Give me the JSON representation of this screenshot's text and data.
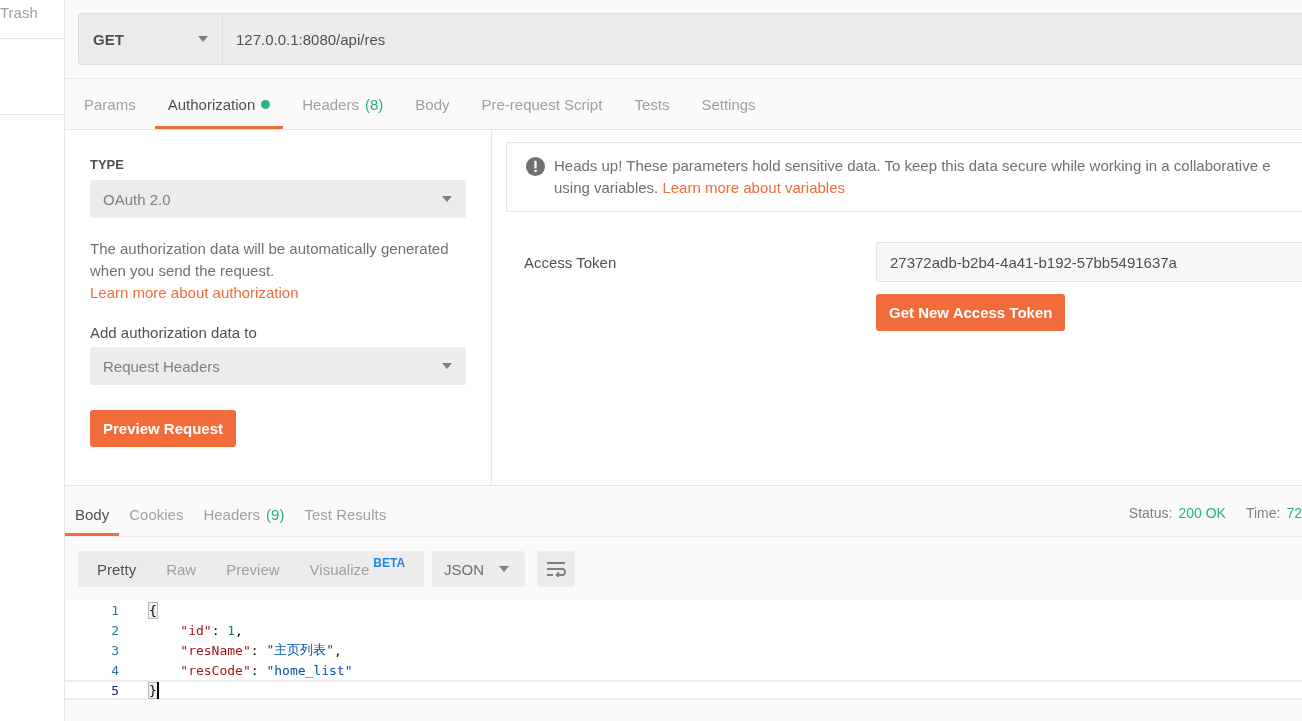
{
  "sidebar": {
    "items": [
      {
        "label": "Trash"
      }
    ]
  },
  "request": {
    "method": "GET",
    "url": "127.0.0.1:8080/api/res"
  },
  "request_tabs": [
    {
      "label": "Params",
      "selected": false
    },
    {
      "label": "Authorization",
      "selected": true,
      "dot": true
    },
    {
      "label": "Headers",
      "count": "(8)",
      "selected": false
    },
    {
      "label": "Body",
      "selected": false
    },
    {
      "label": "Pre-request Script",
      "selected": false
    },
    {
      "label": "Tests",
      "selected": false
    },
    {
      "label": "Settings",
      "selected": false
    }
  ],
  "auth": {
    "type_label": "TYPE",
    "type": "OAuth 2.0",
    "description": "The authorization data will be automatically generated when you send the request. ",
    "description_link": "Learn more about authorization",
    "add_to_label": "Add authorization data to",
    "add_to": "Request Headers",
    "preview_button": "Preview Request"
  },
  "notice": {
    "line_1": "Heads up! These parameters hold sensitive data. To keep this data secure while working in a collaborative e",
    "line_2": "using variables. ",
    "link": "Learn more about variables"
  },
  "access_token": {
    "label": "Access Token",
    "value": "27372adb-b2b4-4a41-b192-57bb5491637a",
    "button": "Get New Access Token"
  },
  "response_tabs": [
    {
      "label": "Body",
      "selected": true
    },
    {
      "label": "Cookies",
      "selected": false
    },
    {
      "label": "Headers",
      "count": "(9)",
      "selected": false
    },
    {
      "label": "Test Results",
      "selected": false
    }
  ],
  "status": {
    "label": "Status:",
    "value": "200 OK"
  },
  "time": {
    "label": "Time:",
    "value": "72"
  },
  "view_modes": [
    {
      "label": "Pretty",
      "selected": true
    },
    {
      "label": "Raw",
      "selected": false
    },
    {
      "label": "Preview",
      "selected": false
    },
    {
      "label": "Visualize",
      "badge": "BETA",
      "selected": false
    }
  ],
  "format": "JSON",
  "code": {
    "lines": [
      {
        "number": "1",
        "active": false,
        "tokens": [
          {
            "kind": "bracket",
            "text": "{"
          }
        ]
      },
      {
        "number": "2",
        "active": false,
        "tokens": [
          {
            "kind": "key",
            "text": "    \"id\""
          },
          {
            "kind": "punct",
            "text": ": "
          },
          {
            "kind": "number",
            "text": "1"
          },
          {
            "kind": "punct",
            "text": ","
          }
        ]
      },
      {
        "number": "3",
        "active": false,
        "tokens": [
          {
            "kind": "key",
            "text": "    \"resName\""
          },
          {
            "kind": "punct",
            "text": ": "
          },
          {
            "kind": "string",
            "text": "\"主页列表\""
          },
          {
            "kind": "punct",
            "text": ","
          }
        ]
      },
      {
        "number": "4",
        "active": false,
        "tokens": [
          {
            "kind": "key",
            "text": "    \"resCode\""
          },
          {
            "kind": "punct",
            "text": ": "
          },
          {
            "kind": "string",
            "text": "\"home_list\""
          }
        ]
      },
      {
        "number": "5",
        "active": true,
        "tokens": [
          {
            "kind": "bracket",
            "text": "}"
          }
        ]
      }
    ]
  }
}
